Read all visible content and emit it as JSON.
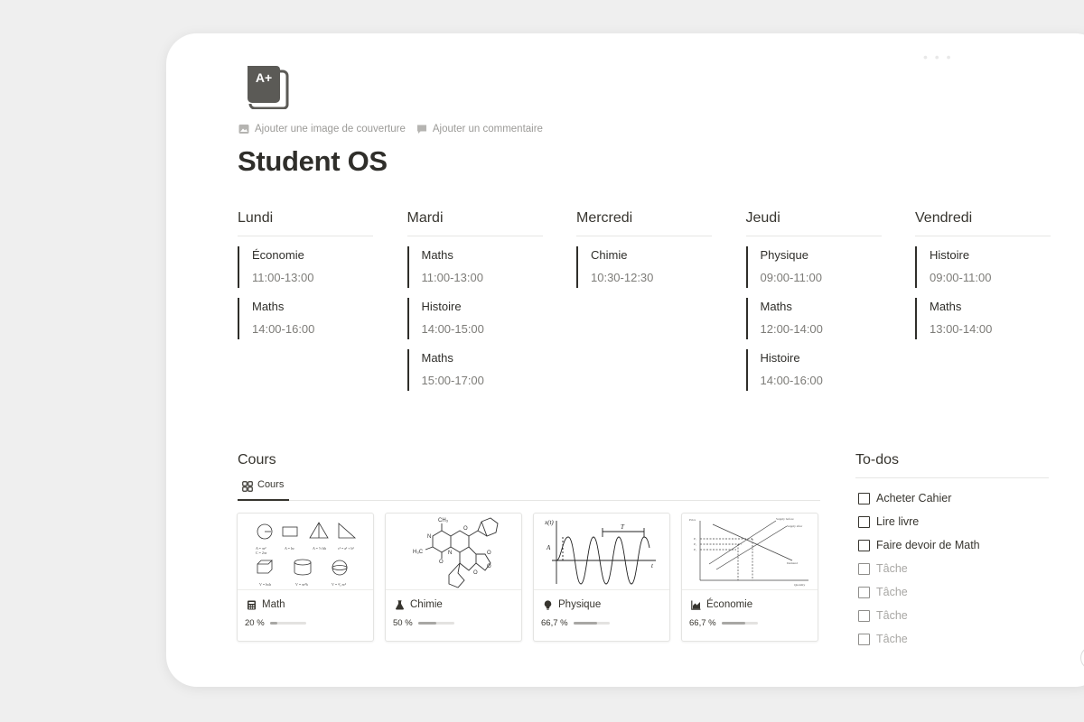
{
  "page": {
    "title": "Student OS",
    "icon": "aplus-document-icon",
    "add_cover_label": "Ajouter une image de couverture",
    "add_comment_label": "Ajouter un commentaire"
  },
  "schedule": [
    {
      "day": "Lundi",
      "slots": [
        {
          "subject": "Économie",
          "time": "11:00-13:00"
        },
        {
          "subject": "Maths",
          "time": "14:00-16:00"
        }
      ]
    },
    {
      "day": "Mardi",
      "slots": [
        {
          "subject": "Maths",
          "time": "11:00-13:00"
        },
        {
          "subject": "Histoire",
          "time": "14:00-15:00"
        },
        {
          "subject": "Maths",
          "time": "15:00-17:00"
        }
      ]
    },
    {
      "day": "Mercredi",
      "slots": [
        {
          "subject": "Chimie",
          "time": "10:30-12:30"
        }
      ]
    },
    {
      "day": "Jeudi",
      "slots": [
        {
          "subject": "Physique",
          "time": "09:00-11:00"
        },
        {
          "subject": "Maths",
          "time": "12:00-14:00"
        },
        {
          "subject": "Histoire",
          "time": "14:00-16:00"
        }
      ]
    },
    {
      "day": "Vendredi",
      "slots": [
        {
          "subject": "Histoire",
          "time": "09:00-11:00"
        },
        {
          "subject": "Maths",
          "time": "13:00-14:00"
        }
      ]
    }
  ],
  "cours": {
    "heading": "Cours",
    "tab_label": "Cours",
    "tab_icon": "gallery-grid-icon",
    "cards": [
      {
        "name": "Math",
        "icon": "calculator-icon",
        "progress_label": "20 %",
        "progress": 0.2
      },
      {
        "name": "Chimie",
        "icon": "flask-icon",
        "progress_label": "50 %",
        "progress": 0.5
      },
      {
        "name": "Physique",
        "icon": "lightbulb-icon",
        "progress_label": "66,7 %",
        "progress": 0.667
      },
      {
        "name": "Économie",
        "icon": "area-chart-icon",
        "progress_label": "66,7 %",
        "progress": 0.667
      }
    ]
  },
  "todos": {
    "heading": "To-dos",
    "items": [
      {
        "label": "Acheter Cahier",
        "checked": false,
        "placeholder": false
      },
      {
        "label": "Lire livre",
        "checked": false,
        "placeholder": false
      },
      {
        "label": "Faire devoir de Math",
        "checked": false,
        "placeholder": false
      },
      {
        "label": "Tâche",
        "checked": false,
        "placeholder": true
      },
      {
        "label": "Tâche",
        "checked": false,
        "placeholder": true
      },
      {
        "label": "Tâche",
        "checked": false,
        "placeholder": true
      },
      {
        "label": "Tâche",
        "checked": false,
        "placeholder": true
      }
    ]
  },
  "colors": {
    "text": "#37352f",
    "muted": "#7d7c78",
    "accent_bar": "#2f2e2a",
    "progress": "#a8a7a4"
  }
}
